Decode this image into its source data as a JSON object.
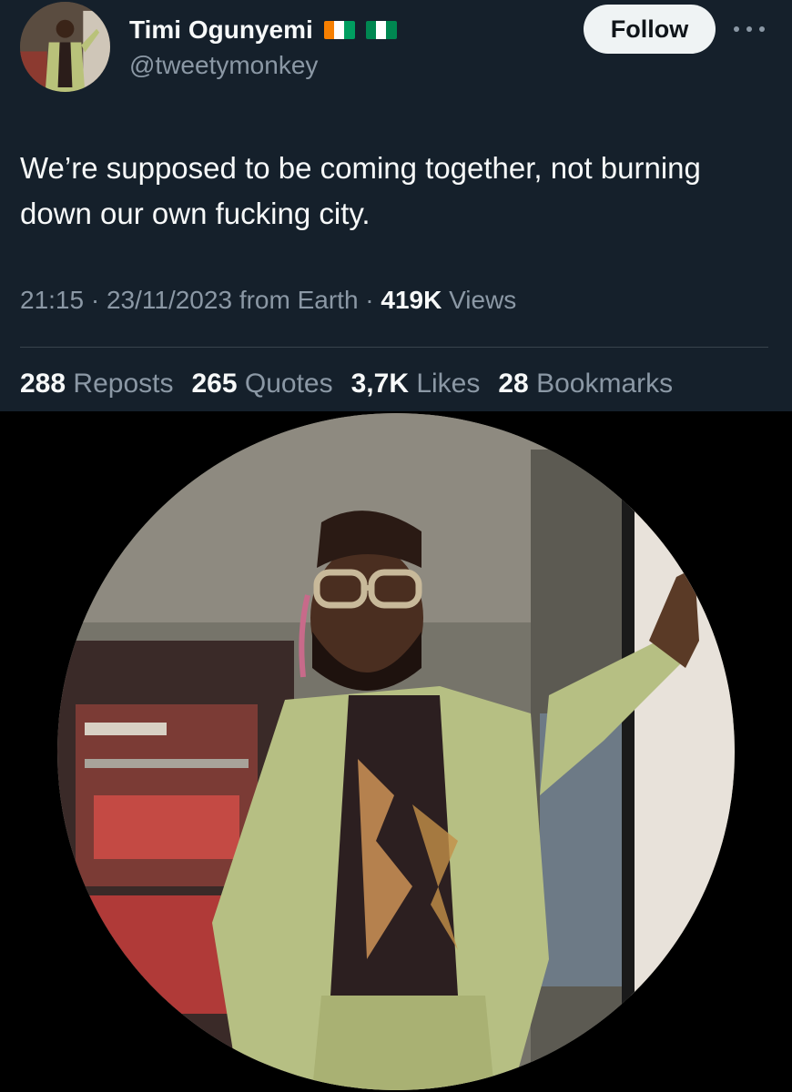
{
  "author": {
    "display_name": "Timi Ogunyemi",
    "handle": "@tweetymonkey",
    "flags": [
      "cote-divoire-flag-icon",
      "nigeria-flag-icon"
    ],
    "avatar": "profile-photo-avatar"
  },
  "actions": {
    "follow_label": "Follow",
    "more_icon": "more-options-icon"
  },
  "tweet": {
    "text": "We’re supposed to be coming together, not burning down our own fucking city."
  },
  "meta": {
    "time": "21:15",
    "sep1": "·",
    "date": "23/11/2023",
    "source": "from Earth",
    "sep2": "·",
    "views_count": "419K",
    "views_label": "Views"
  },
  "stats": {
    "reposts_count": "288",
    "reposts_label": "Reposts",
    "quotes_count": "265",
    "quotes_label": "Quotes",
    "likes_count": "3,7K",
    "likes_label": "Likes",
    "bookmarks_count": "28",
    "bookmarks_label": "Bookmarks"
  },
  "colors": {
    "tweet_bg": "#15202b",
    "text_primary": "#f7f9f9",
    "text_secondary": "#8b98a5",
    "follow_bg": "#eff3f4",
    "divider": "#38444d"
  }
}
